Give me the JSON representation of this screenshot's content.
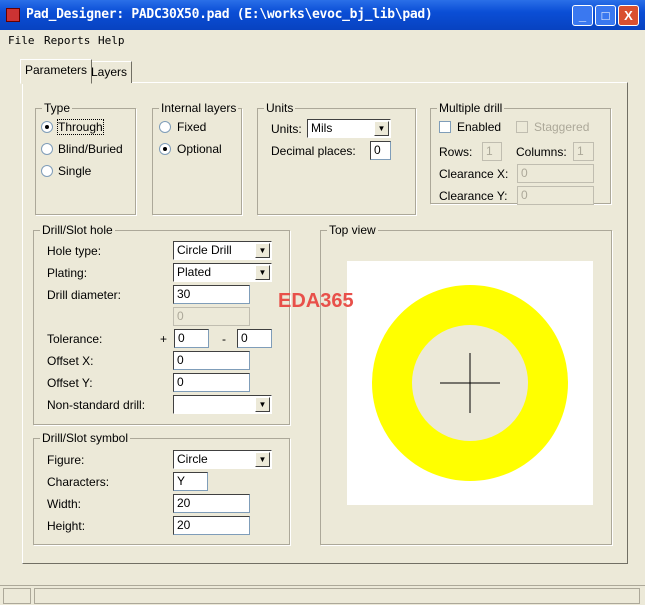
{
  "window": {
    "title": "Pad_Designer: PADC30X50.pad (E:\\works\\evoc_bj_lib\\pad)",
    "minimize": "_",
    "maximize": "□",
    "close": "X"
  },
  "menu": [
    "File",
    "Reports",
    "Help"
  ],
  "tabs": [
    "Parameters",
    "Layers"
  ],
  "type": {
    "label": "Type",
    "options": [
      "Through",
      "Blind/Buried",
      "Single"
    ],
    "selected": "Through"
  },
  "internal_layers": {
    "label": "Internal layers",
    "options": [
      "Fixed",
      "Optional"
    ],
    "selected": "Optional"
  },
  "units": {
    "label": "Units",
    "units_label": "Units:",
    "units_value": "Mils",
    "decimal_label": "Decimal places:",
    "decimal_value": "0"
  },
  "multiple_drill": {
    "label": "Multiple drill",
    "enabled": "Enabled",
    "staggered": "Staggered",
    "rows_label": "Rows:",
    "rows": "1",
    "columns_label": "Columns:",
    "columns": "1",
    "clearance_x_label": "Clearance X:",
    "clearance_x": "0",
    "clearance_y_label": "Clearance Y:",
    "clearance_y": "0"
  },
  "drill_hole": {
    "label": "Drill/Slot hole",
    "hole_type_label": "Hole type:",
    "hole_type": "Circle Drill",
    "plating_label": "Plating:",
    "plating": "Plated",
    "diameter_label": "Drill diameter:",
    "diameter": "30",
    "diameter2": "0",
    "tolerance_label": "Tolerance:",
    "plus": "+",
    "tol_plus": "0",
    "minus": "-",
    "tol_minus": "0",
    "offset_x_label": "Offset X:",
    "offset_x": "0",
    "offset_y_label": "Offset Y:",
    "offset_y": "0",
    "nonstandard_label": "Non-standard drill:",
    "nonstandard": ""
  },
  "drill_symbol": {
    "label": "Drill/Slot symbol",
    "figure_label": "Figure:",
    "figure": "Circle",
    "characters_label": "Characters:",
    "characters": "Y",
    "width_label": "Width:",
    "width": "20",
    "height_label": "Height:",
    "height": "20"
  },
  "top_view": {
    "label": "Top view",
    "pad_color": "#ffff00",
    "hole_color": "#ece9d8"
  },
  "watermark": "EDA365"
}
